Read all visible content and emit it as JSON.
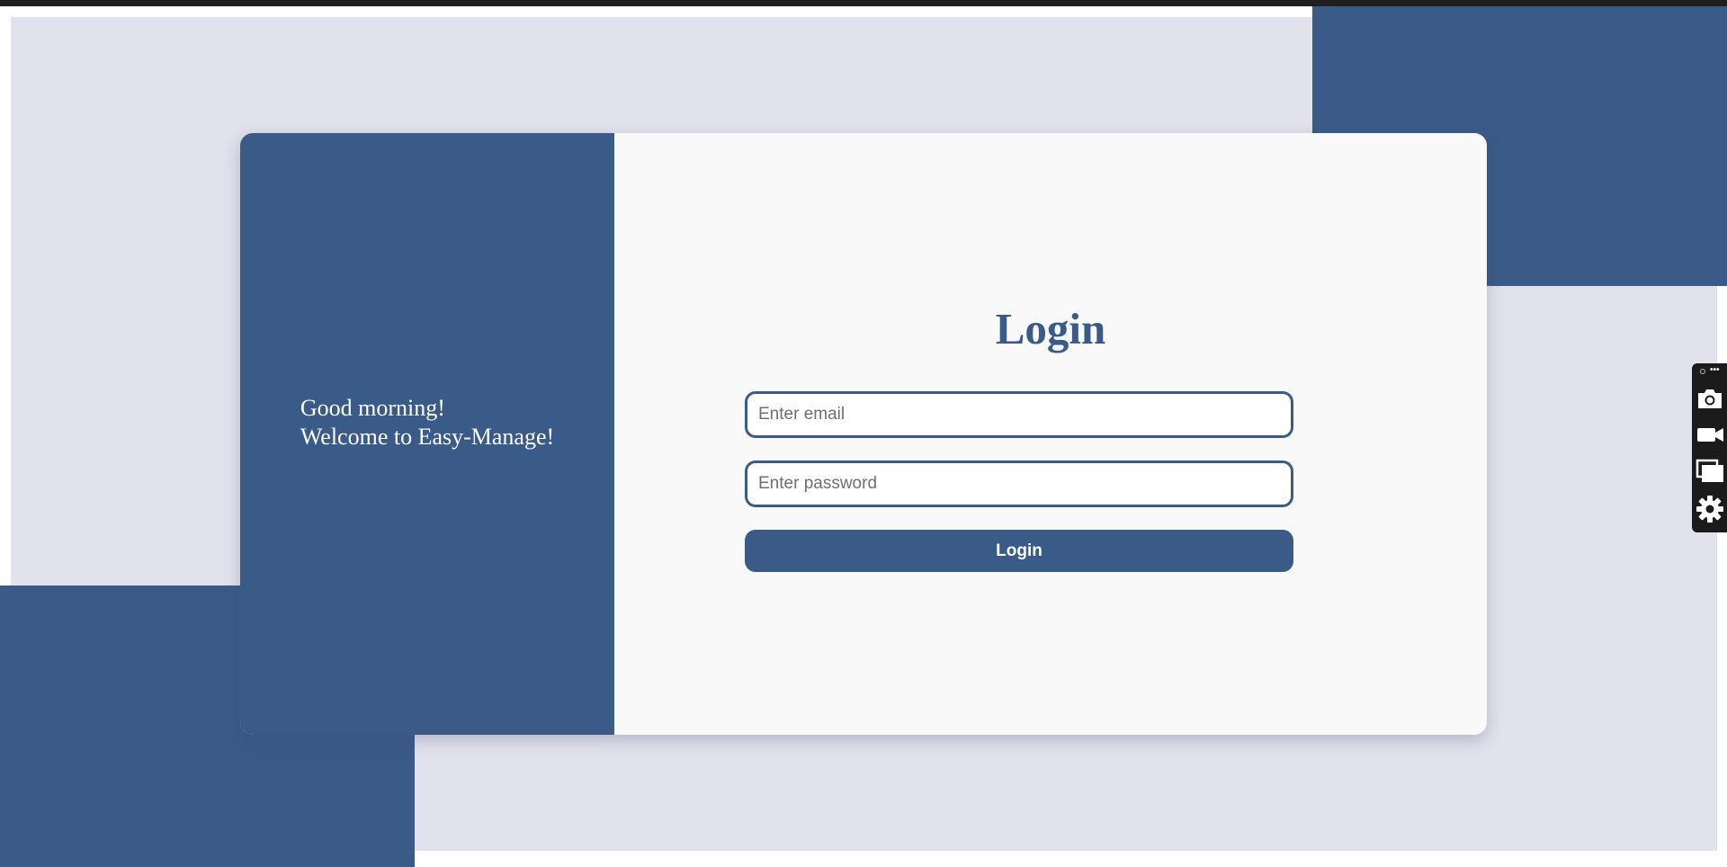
{
  "welcome": {
    "line1": "Good morning!",
    "line2": "Welcome to Easy-Manage!"
  },
  "login": {
    "title": "Login",
    "email_placeholder": "Enter email",
    "password_placeholder": "Enter password",
    "button_label": "Login"
  },
  "toolbar": {
    "more_label": "•••",
    "icons": [
      "camera-icon",
      "video-icon",
      "window-icon",
      "gear-icon"
    ]
  },
  "colors": {
    "accent": "#3a5b87",
    "background_panel": "#e2e2ec",
    "card": "#f9f9fa",
    "toolbar": "#1b1b1b"
  }
}
